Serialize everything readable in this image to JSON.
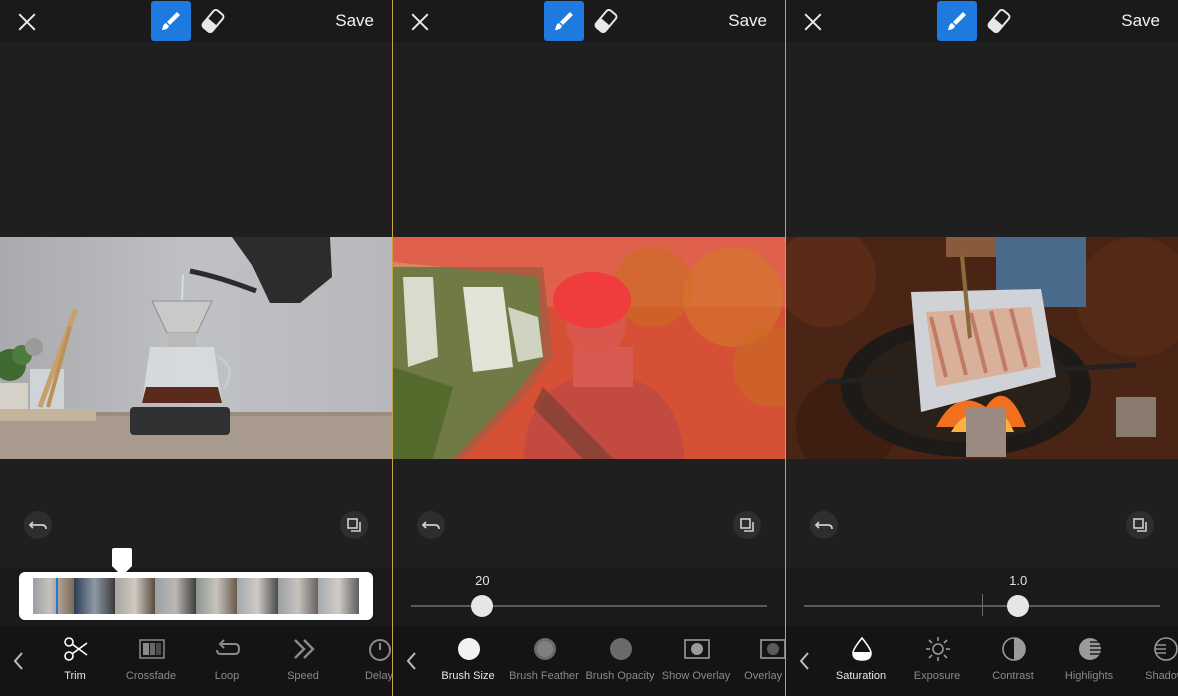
{
  "panels": [
    {
      "id": "video",
      "save_label": "Save",
      "tools": [
        {
          "label": "Trim",
          "icon": "scissors-icon",
          "active": true
        },
        {
          "label": "Crossfade",
          "icon": "crossfade-icon",
          "active": false
        },
        {
          "label": "Loop",
          "icon": "loop-icon",
          "active": false
        },
        {
          "label": "Speed",
          "icon": "speed-icon",
          "active": false
        },
        {
          "label": "Delay",
          "icon": "delay-icon",
          "active": false
        }
      ],
      "image_desc": "pour-over coffee"
    },
    {
      "id": "brush",
      "save_label": "Save",
      "slider_value": "20",
      "slider_fraction": 0.2,
      "tools": [
        {
          "label": "Brush Size",
          "icon": "brush-size-icon",
          "active": true
        },
        {
          "label": "Brush Feather",
          "icon": "brush-feather-icon",
          "active": false
        },
        {
          "label": "Brush Opacity",
          "icon": "brush-opacity-icon",
          "active": false
        },
        {
          "label": "Show Overlay",
          "icon": "show-overlay-icon",
          "active": false
        },
        {
          "label": "Overlay Op",
          "icon": "overlay-opacity-icon",
          "active": false
        }
      ]
    },
    {
      "id": "adjust",
      "save_label": "Save",
      "slider_value": "1.0",
      "slider_fraction": 0.6,
      "tools": [
        {
          "label": "Saturation",
          "icon": "saturation-icon",
          "active": true
        },
        {
          "label": "Exposure",
          "icon": "exposure-icon",
          "active": false
        },
        {
          "label": "Contrast",
          "icon": "contrast-icon",
          "active": false
        },
        {
          "label": "Highlights",
          "icon": "highlights-icon",
          "active": false
        },
        {
          "label": "Shadow",
          "icon": "shadows-icon",
          "active": false
        }
      ]
    }
  ],
  "colors": {
    "accent": "#1f7ae0",
    "background": "#1f1f1f",
    "divider": "#c8a24a"
  }
}
